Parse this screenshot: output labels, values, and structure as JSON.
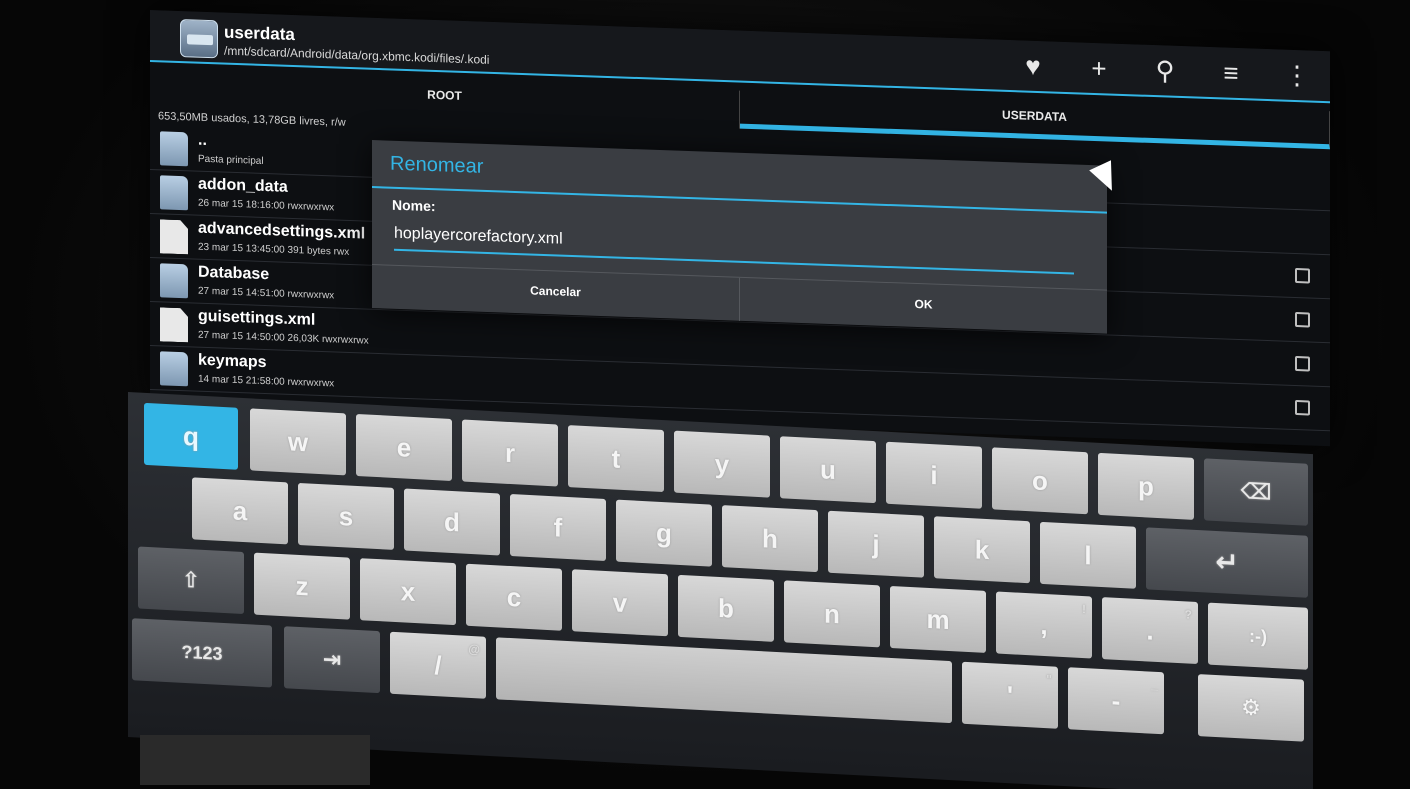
{
  "header": {
    "title": "userdata",
    "path": "/mnt/sdcard/Android/data/org.xbmc.kodi/files/.kodi",
    "icons": [
      "heart-icon",
      "plus-icon",
      "search-icon",
      "sort-icon",
      "overflow-icon"
    ],
    "icon_glyphs": [
      "♥",
      "+",
      "⚲",
      "≡",
      "⋮"
    ]
  },
  "tabs": [
    {
      "label": "ROOT"
    },
    {
      "label": "USERDATA"
    }
  ],
  "storage_info": "653,50MB usados, 13,78GB livres, r/w",
  "files": [
    {
      "name": "..",
      "meta": "Pasta principal",
      "type": "folder"
    },
    {
      "name": "addon_data",
      "meta": "26 mar 15 18:16:00   rwxrwxrwx",
      "type": "folder"
    },
    {
      "name": "advancedsettings.xml",
      "meta": "23 mar 15 13:45:00  391 bytes  rwx",
      "type": "file"
    },
    {
      "name": "Database",
      "meta": "27 mar 15 14:51:00   rwxrwxrwx",
      "type": "folder"
    },
    {
      "name": "guisettings.xml",
      "meta": "27 mar 15 14:50:00  26,03K  rwxrwxrwx",
      "type": "file"
    },
    {
      "name": "keymaps",
      "meta": "14 mar 15 21:58:00   rwxrwxrwx",
      "type": "folder"
    }
  ],
  "dialog": {
    "title": "Renomear",
    "field_label": "Nome:",
    "field_value": "hoplayercorefactory.xml",
    "cancel_label": "Cancelar",
    "ok_label": "OK"
  },
  "keyboard": {
    "row1": [
      "q",
      "w",
      "e",
      "r",
      "t",
      "y",
      "u",
      "i",
      "o",
      "p"
    ],
    "row2": [
      "a",
      "s",
      "d",
      "f",
      "g",
      "h",
      "j",
      "k",
      "l"
    ],
    "row3": [
      "z",
      "x",
      "c",
      "v",
      "b",
      "n",
      "m",
      ",",
      "."
    ],
    "row3_sup": [
      "",
      "",
      "",
      "",
      "",
      "",
      "",
      "!",
      "?"
    ],
    "smiley_label": ":-)",
    "symbols_label": "?123",
    "slash_label": "/",
    "slash_sup": "@",
    "apostrophe_label": "'",
    "apostrophe_sup": "\"",
    "dash_label": "-",
    "dash_sup": "_",
    "backspace_icon": "⌫",
    "enter_icon": "↵",
    "shift_icon": "⇧",
    "tab_icon": "⇥",
    "settings_icon": "⚙"
  }
}
